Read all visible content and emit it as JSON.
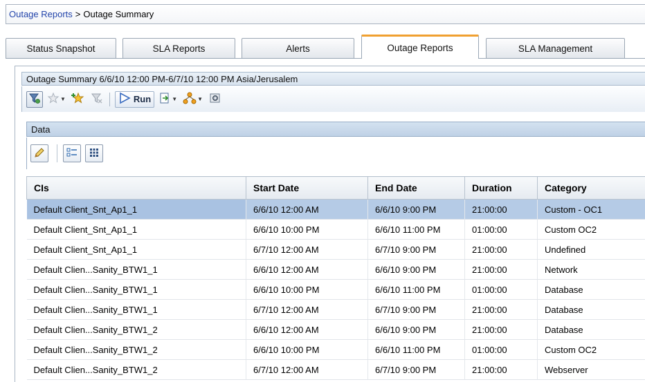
{
  "breadcrumb": {
    "link": "Outage Reports",
    "separator": ">",
    "current": "Outage Summary"
  },
  "tabs": [
    {
      "label": "Status Snapshot",
      "active": false
    },
    {
      "label": "SLA Reports",
      "active": false
    },
    {
      "label": "Alerts",
      "active": false
    },
    {
      "label": "Outage Reports",
      "active": true
    },
    {
      "label": "SLA Management",
      "active": false
    }
  ],
  "panel": {
    "title": "Outage Summary 6/6/10 12:00 PM-6/7/10 12:00 PM Asia/Jerusalem"
  },
  "toolbar": {
    "run_label": "Run",
    "icons": [
      "filter-icon",
      "favorites-icon",
      "add-favorite-icon",
      "clear-filter-icon",
      "run-icon",
      "export-icon",
      "share-icon",
      "settings-icon"
    ]
  },
  "data_section": {
    "title": "Data",
    "icons": [
      "edit-icon",
      "list-view-icon",
      "grid-view-icon"
    ]
  },
  "table": {
    "columns": [
      "CIs",
      "Start Date",
      "End Date",
      "Duration",
      "Category"
    ],
    "rows": [
      [
        "Default Client_Snt_Ap1_1",
        "6/6/10 12:00 AM",
        "6/6/10 9:00 PM",
        "21:00:00",
        "Custom - OC1"
      ],
      [
        "Default Client_Snt_Ap1_1",
        "6/6/10 10:00 PM",
        "6/6/10 11:00 PM",
        "01:00:00",
        "Custom OC2"
      ],
      [
        "Default Client_Snt_Ap1_1",
        "6/7/10 12:00 AM",
        "6/7/10 9:00 PM",
        "21:00:00",
        "Undefined"
      ],
      [
        "Default Clien...Sanity_BTW1_1",
        "6/6/10 12:00 AM",
        "6/6/10 9:00 PM",
        "21:00:00",
        "Network"
      ],
      [
        "Default Clien...Sanity_BTW1_1",
        "6/6/10 10:00 PM",
        "6/6/10 11:00 PM",
        "01:00:00",
        "Database"
      ],
      [
        "Default Clien...Sanity_BTW1_1",
        "6/7/10 12:00 AM",
        "6/7/10 9:00 PM",
        "21:00:00",
        "Database"
      ],
      [
        "Default Clien...Sanity_BTW1_2",
        "6/6/10 12:00 AM",
        "6/6/10 9:00 PM",
        "21:00:00",
        "Database"
      ],
      [
        "Default Clien...Sanity_BTW1_2",
        "6/6/10 10:00 PM",
        "6/6/10 11:00 PM",
        "01:00:00",
        "Custom OC2"
      ],
      [
        "Default Clien...Sanity_BTW1_2",
        "6/7/10 12:00 AM",
        "6/7/10 9:00 PM",
        "21:00:00",
        "Webserver"
      ]
    ],
    "selected_row": 0
  },
  "colors": {
    "active_tab_accent": "#f0a030",
    "selected_row": "#b5cbe6",
    "link": "#2244aa"
  }
}
